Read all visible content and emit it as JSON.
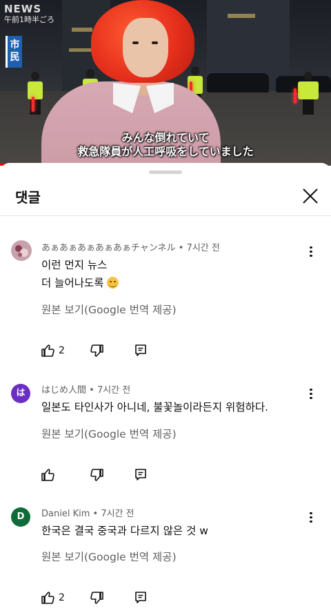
{
  "video": {
    "logo_text": "NEWS",
    "time_caption": "午前1時半ごろ",
    "tag_text": "市民",
    "subtitle_line1": "みんな倒れていて",
    "subtitle_line2": "救急隊員が人工呼吸をしていました",
    "progress_fraction": 0.55
  },
  "sheet": {
    "title": "댓글",
    "close_icon": "close-x-icon"
  },
  "comments": [
    {
      "author": "あぁあぁあぁあぁあぁチャンネル",
      "time": "7시간 전",
      "lines": [
        "이런 먼지 뉴스",
        "더 늘어나도록"
      ],
      "has_emoji": true,
      "translate_label": "원본 보기(Google 번역 제공)",
      "likes": "2",
      "avatar_color": "#b9808f"
    },
    {
      "author": "はじめ人間",
      "time": "7시간 전",
      "lines": [
        "일본도 타인사가 아니네, 불꽃놀이라든지 위험하다."
      ],
      "has_emoji": false,
      "translate_label": "원본 보기(Google 번역 제공)",
      "likes": "",
      "avatar_letter": "は",
      "avatar_color": "#6a2ec2"
    },
    {
      "author": "Daniel Kim",
      "time": "7시간 전",
      "lines": [
        "한국은 결국 중국과 다르지 않은 것 w"
      ],
      "has_emoji": false,
      "translate_label": "원본 보기(Google 번역 제공)",
      "likes": "2",
      "avatar_letter": "D",
      "avatar_color": "#0f6b3a"
    }
  ],
  "meta_separator": " • "
}
